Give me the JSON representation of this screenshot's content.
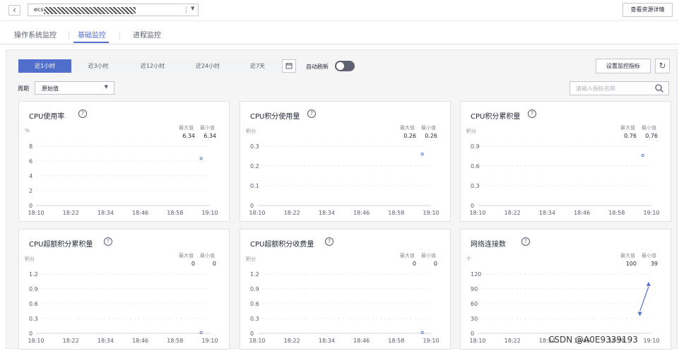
{
  "header": {
    "back_icon": "chevron-left-icon",
    "resource_prefix": "ecs",
    "resource_mask": "obscured",
    "detail_button": "查看资源详情"
  },
  "tabs": [
    {
      "label": "操作系统监控",
      "active": false
    },
    {
      "label": "基础监控",
      "active": true
    },
    {
      "label": "进程监控",
      "active": false
    }
  ],
  "toolbar": {
    "ranges": [
      {
        "label": "近1小时",
        "active": true
      },
      {
        "label": "近3小时",
        "active": false
      },
      {
        "label": "近12小时",
        "active": false
      },
      {
        "label": "近24小时",
        "active": false
      },
      {
        "label": "近7天",
        "active": false
      }
    ],
    "calendar_icon": "calendar-icon",
    "auto_refresh_label": "自动刷新",
    "auto_refresh_on": false,
    "set_metrics_button": "设置监控指标",
    "refresh_icon": "refresh-icon",
    "period_label": "周期",
    "period_value": "原始值",
    "search_placeholder": "请输入指标名称",
    "search_icon": "search-icon"
  },
  "chart_data": [
    {
      "type": "scatter",
      "title": "CPU使用率",
      "unit": "%",
      "max_label": "最大值",
      "min_label": "最小值",
      "max": "6.34",
      "min": "6.34",
      "x_ticks": [
        "18:10",
        "18:22",
        "18:34",
        "18:46",
        "18:58",
        "19:10"
      ],
      "y_ticks": [
        "0",
        "2",
        "4",
        "6",
        "8"
      ],
      "ylim": [
        0,
        8
      ],
      "points": [
        {
          "x": "19:07",
          "y": 6.34
        }
      ],
      "color": "#526ecc"
    },
    {
      "type": "scatter",
      "title": "CPU积分使用量",
      "unit": "积分",
      "max_label": "最大值",
      "min_label": "最小值",
      "max": "0.26",
      "min": "0.26",
      "x_ticks": [
        "18:10",
        "18:22",
        "18:34",
        "18:46",
        "18:58",
        "19:10"
      ],
      "y_ticks": [
        "0",
        "0.1",
        "0.2",
        "0.3"
      ],
      "ylim": [
        0,
        0.3
      ],
      "points": [
        {
          "x": "19:07",
          "y": 0.26
        }
      ],
      "color": "#526ecc"
    },
    {
      "type": "scatter",
      "title": "CPU积分累积量",
      "unit": "积分",
      "max_label": "最大值",
      "min_label": "最小值",
      "max": "0.76",
      "min": "0.76",
      "x_ticks": [
        "18:10",
        "18:22",
        "18:34",
        "18:46",
        "18:58",
        "19:10"
      ],
      "y_ticks": [
        "0",
        "0.3",
        "0.6",
        "0.9"
      ],
      "ylim": [
        0,
        0.9
      ],
      "points": [
        {
          "x": "19:07",
          "y": 0.76
        }
      ],
      "color": "#526ecc"
    },
    {
      "type": "scatter",
      "title": "CPU超额积分累积量",
      "unit": "积分",
      "max_label": "最大值",
      "min_label": "最小值",
      "max": "0",
      "min": "0",
      "x_ticks": [
        "18:10",
        "18:22",
        "18:34",
        "18:46",
        "18:58",
        "19:10"
      ],
      "y_ticks": [
        "0",
        "0.3",
        "0.6",
        "0.9",
        "1.2"
      ],
      "ylim": [
        0,
        1.2
      ],
      "points": [
        {
          "x": "19:07",
          "y": 0
        }
      ],
      "color": "#526ecc"
    },
    {
      "type": "scatter",
      "title": "CPU超额积分收费量",
      "unit": "积分",
      "max_label": "最大值",
      "min_label": "最小值",
      "max": "0",
      "min": "0",
      "x_ticks": [
        "18:10",
        "18:22",
        "18:34",
        "18:46",
        "18:58",
        "19:10"
      ],
      "y_ticks": [
        "0",
        "0.3",
        "0.6",
        "0.9",
        "1.2"
      ],
      "ylim": [
        0,
        1.2
      ],
      "points": [
        {
          "x": "19:07",
          "y": 0
        }
      ],
      "color": "#526ecc"
    },
    {
      "type": "line",
      "title": "网络连接数",
      "unit": "个",
      "max_label": "最大值",
      "min_label": "最小值",
      "max": "100",
      "min": "39",
      "x_ticks": [
        "18:10",
        "18:22",
        "18:34",
        "18:46",
        "18:58",
        "19:10"
      ],
      "y_ticks": [
        "0",
        "30",
        "60",
        "90",
        "120"
      ],
      "ylim": [
        0,
        120
      ],
      "points": [
        {
          "x": "19:06",
          "y": 39
        },
        {
          "x": "19:09",
          "y": 100
        }
      ],
      "color": "#526ecc"
    }
  ],
  "watermark": "CSDN @A0E9339193"
}
